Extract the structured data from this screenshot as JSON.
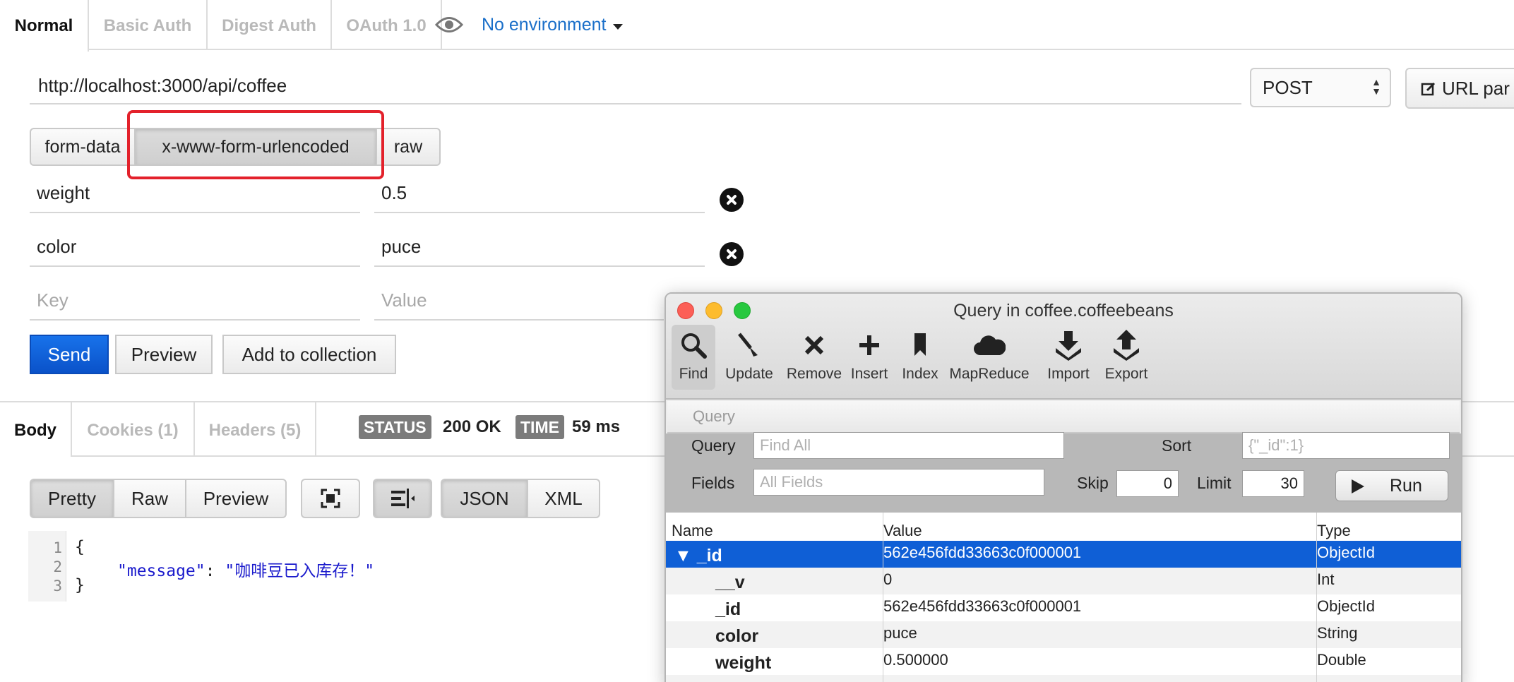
{
  "auth_tabs": [
    "Normal",
    "Basic Auth",
    "Digest Auth",
    "OAuth 1.0"
  ],
  "environment": "No environment",
  "request": {
    "url": "http://localhost:3000/api/coffee",
    "method": "POST",
    "url_params_label": "URL par"
  },
  "body_types": [
    "form-data",
    "x-www-form-urlencoded",
    "raw"
  ],
  "params": [
    {
      "key": "weight",
      "value": "0.5"
    },
    {
      "key": "color",
      "value": "puce"
    }
  ],
  "placeholders": {
    "key": "Key",
    "value": "Value"
  },
  "actions": {
    "send": "Send",
    "preview": "Preview",
    "add": "Add to collection"
  },
  "response": {
    "tabs": [
      "Body",
      "Cookies (1)",
      "Headers (5)"
    ],
    "status_label": "STATUS",
    "status": "200 OK",
    "time_label": "TIME",
    "time": "59 ms",
    "views": [
      "Pretty",
      "Raw",
      "Preview"
    ],
    "formats": [
      "JSON",
      "XML"
    ],
    "line_numbers": [
      "1",
      "2",
      "3"
    ],
    "open_brace": "{",
    "close_brace": "}",
    "json_key": "\"message\"",
    "json_colon": ":",
    "json_value": "\"咖啡豆已入库存！\""
  },
  "query_window": {
    "title": "Query in coffee.coffeebeans",
    "toolbar": [
      "Find",
      "Update",
      "Remove",
      "Insert",
      "Index",
      "MapReduce",
      "Import",
      "Export"
    ],
    "section": "Query",
    "form": {
      "query_label": "Query",
      "query_placeholder": "Find All",
      "sort_label": "Sort",
      "sort_placeholder": "{\"_id\":1}",
      "fields_label": "Fields",
      "fields_placeholder": "All Fields",
      "skip_label": "Skip",
      "skip": "0",
      "limit_label": "Limit",
      "limit": "30",
      "run": "Run"
    },
    "columns": [
      "Name",
      "Value",
      "Type"
    ],
    "rows": [
      {
        "name": "▼ _id",
        "value": "562e456fdd33663c0f000001",
        "type": "ObjectId"
      },
      {
        "name": "__v",
        "value": "0",
        "type": "Int"
      },
      {
        "name": "_id",
        "value": "562e456fdd33663c0f000001",
        "type": "ObjectId"
      },
      {
        "name": "color",
        "value": "puce",
        "type": "String"
      },
      {
        "name": "weight",
        "value": "0.500000",
        "type": "Double"
      }
    ]
  },
  "colors": {
    "accent_blue": "#0a52c9",
    "selection": "#0f5fd6",
    "highlight_red": "#e3212b"
  }
}
